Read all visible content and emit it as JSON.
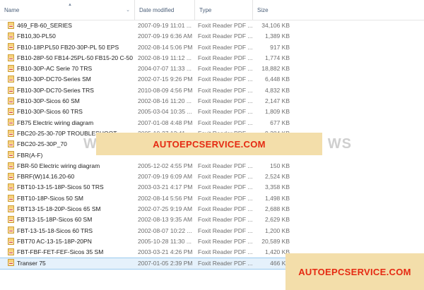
{
  "columns": {
    "name": "Name",
    "date": "Date modified",
    "type": "Type",
    "size": "Size"
  },
  "files": [
    {
      "name": "469_FB-60_SERIES",
      "date": "2007-09-19 11:01 ...",
      "type": "Foxit Reader PDF ...",
      "size": "34,106 KB"
    },
    {
      "name": "FB10,30-PL50",
      "date": "2007-09-19 6:36 AM",
      "type": "Foxit Reader PDF ...",
      "size": "1,389 KB"
    },
    {
      "name": "FB10-18P.PL50 FB20-30P-PL 50 EPS",
      "date": "2002-08-14 5:06 PM",
      "type": "Foxit Reader PDF ...",
      "size": "917 KB"
    },
    {
      "name": "FB10-28P-50 FB14-25PL-50 FB15-20 C-50 ...",
      "date": "2002-08-19 11:12 ...",
      "type": "Foxit Reader PDF ...",
      "size": "1,774 KB"
    },
    {
      "name": "FB10-30P-AC Serie 70 TRS",
      "date": "2004-07-07 11:33 ...",
      "type": "Foxit Reader PDF ...",
      "size": "18,882 KB"
    },
    {
      "name": "FB10-30P-DC70-Series SM",
      "date": "2002-07-15 9:26 PM",
      "type": "Foxit Reader PDF ...",
      "size": "6,448 KB"
    },
    {
      "name": "FB10-30P-DC70-Series TRS",
      "date": "2010-08-09 4:56 PM",
      "type": "Foxit Reader PDF ...",
      "size": "4,832 KB"
    },
    {
      "name": "FB10-30P-Sicos 60 SM",
      "date": "2002-08-16 11:20 ...",
      "type": "Foxit Reader PDF ...",
      "size": "2,147 KB"
    },
    {
      "name": "FB10-30P-Sicos 60 TRS",
      "date": "2005-03-04 10:35 ...",
      "type": "Foxit Reader PDF ...",
      "size": "1,809 KB"
    },
    {
      "name": "FB75 Electric wiring diagram",
      "date": "2007-01-08 4:48 PM",
      "type": "Foxit Reader PDF ...",
      "size": "677 KB"
    },
    {
      "name": "FBC20-25-30-70P TROUBLESHOOT",
      "date": "2005-10-27 12:41 ...",
      "type": "Foxit Reader PDF ...",
      "size": "9,284 KB"
    },
    {
      "name": "FBC20-25-30P_70",
      "date": "",
      "type": "",
      "size": ""
    },
    {
      "name": "FBR(A-F)",
      "date": "",
      "type": "",
      "size": ""
    },
    {
      "name": "FBR-50 Electric wiring diagram",
      "date": "2005-12-02 4:55 PM",
      "type": "Foxit Reader PDF ...",
      "size": "150 KB"
    },
    {
      "name": "FBRF(W)14.16.20-60",
      "date": "2007-09-19 6:09 AM",
      "type": "Foxit Reader PDF ...",
      "size": "2,524 KB"
    },
    {
      "name": "FBT10-13-15-18P-Sicos 50 TRS",
      "date": "2003-03-21 4:17 PM",
      "type": "Foxit Reader PDF ...",
      "size": "3,358 KB"
    },
    {
      "name": "FBT10-18P-Sicos 50 SM",
      "date": "2002-08-14 5:56 PM",
      "type": "Foxit Reader PDF ...",
      "size": "1,498 KB"
    },
    {
      "name": "FBT13-15-18-20P-Sicos 65 SM",
      "date": "2002-07-25 9:19 AM",
      "type": "Foxit Reader PDF ...",
      "size": "2,688 KB"
    },
    {
      "name": "FBT13-15-18P-Sicos 60 SM",
      "date": "2002-08-13 9:35 AM",
      "type": "Foxit Reader PDF ...",
      "size": "2,629 KB"
    },
    {
      "name": "FBT-13-15-18-Sicos 60 TRS",
      "date": "2002-08-07 10:22 ...",
      "type": "Foxit Reader PDF ...",
      "size": "1,200 KB"
    },
    {
      "name": "FBT70 AC-13-15-18P-20PN",
      "date": "2005-10-28 11:30 ...",
      "type": "Foxit Reader PDF ...",
      "size": "20,589 KB"
    },
    {
      "name": "FBT-FBF-FET-FEF-Sicos 35 SM",
      "date": "2003-03-21 4:26 PM",
      "type": "Foxit Reader PDF ...",
      "size": "1,420 KB"
    },
    {
      "name": "Transer 75",
      "date": "2007-01-05 2:39 PM",
      "type": "Foxit Reader PDF ...",
      "size": "466 KB"
    }
  ],
  "selected_index": 22,
  "watermark": {
    "left": "WW",
    "right": "WS"
  },
  "banner_text": "AUTOEPCSERVICE.COM",
  "banner_text_corner": "AUTOEPCSERVICE.COM",
  "colors": {
    "banner_bg": "#f3deaa",
    "banner_text": "#e52a12",
    "selection": "#e5f1fb",
    "pdf_icon": "#e8b23a"
  },
  "icons": {
    "file": "pdf-file-icon",
    "sort": "sort-up-icon",
    "dropdown": "chevron-down-icon"
  }
}
